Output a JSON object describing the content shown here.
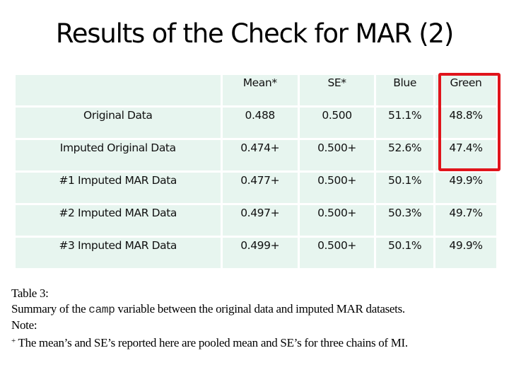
{
  "slide": {
    "title": "Results of the Check for MAR (2)"
  },
  "table": {
    "columns": [
      "",
      "Mean*",
      "SE*",
      "Blue",
      "Green"
    ],
    "highlighted_column": "Green",
    "highlight_color": "#e0141b",
    "cell_background": "#e7f5ef",
    "rows": [
      {
        "label": "Original Data",
        "mean": "0.488",
        "se": "0.500",
        "blue": "51.1%",
        "green": "48.8%"
      },
      {
        "label": "Imputed Original Data",
        "mean": "0.474+",
        "se": "0.500+",
        "blue": "52.6%",
        "green": "47.4%"
      },
      {
        "label": "#1 Imputed MAR Data",
        "mean": "0.477+",
        "se": "0.500+",
        "blue": "50.1%",
        "green": "49.9%"
      },
      {
        "label": "#2 Imputed MAR Data",
        "mean": "0.497+",
        "se": "0.500+",
        "blue": "50.3%",
        "green": "49.7%"
      },
      {
        "label": "#3 Imputed MAR Data",
        "mean": "0.499+",
        "se": "0.500+",
        "blue": "50.1%",
        "green": "49.9%"
      }
    ]
  },
  "caption": {
    "table_label": "Table  3:",
    "summary_prefix": "Summary of the ",
    "summary_code": "camp",
    "summary_suffix": " variable between the original data and imputed MAR datasets.",
    "note_label": "Note:",
    "footnote_marker": "+",
    "footnote_text": " The mean’s and SE’s reported here are pooled mean and SE’s for three chains of MI."
  }
}
